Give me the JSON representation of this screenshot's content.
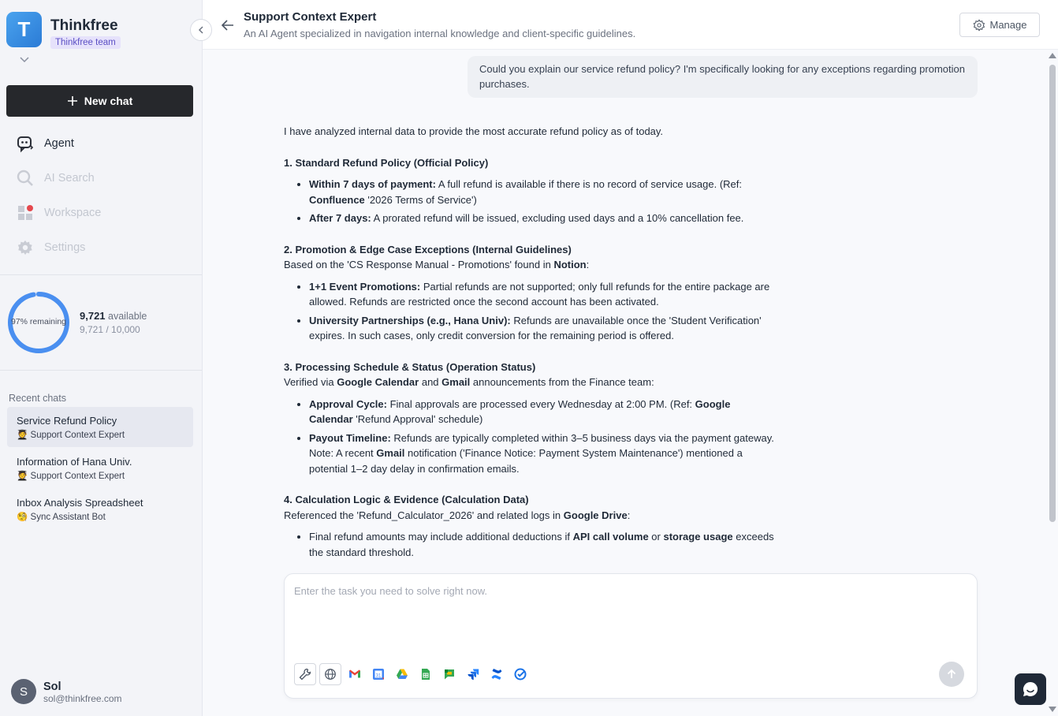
{
  "org": {
    "initial": "T",
    "name": "Thinkfree",
    "badge": "Thinkfree team"
  },
  "sidebar": {
    "new_chat": "New chat",
    "nav": [
      {
        "label": "Agent",
        "icon": "agent-icon",
        "enabled": true
      },
      {
        "label": "AI Search",
        "icon": "search-icon",
        "enabled": false
      },
      {
        "label": "Workspace",
        "icon": "workspace-grid-icon",
        "enabled": false
      },
      {
        "label": "Settings",
        "icon": "gear-icon",
        "enabled": false
      }
    ],
    "credits": {
      "remaining_label": "97% remaining",
      "remaining_fraction": 0.97,
      "available_value": "9,721",
      "available_suffix": "available",
      "total": "9,721 / 10,000"
    },
    "recent_title": "Recent chats",
    "recent": [
      {
        "title": "Service Refund Policy",
        "agent_emoji": "🧑‍🎓",
        "agent": "Support Context Expert",
        "active": true
      },
      {
        "title": "Information of Hana Univ.",
        "agent_emoji": "🧑‍🎓",
        "agent": "Support Context Expert",
        "active": false
      },
      {
        "title": "Inbox Analysis Spreadsheet",
        "agent_emoji": "🧐",
        "agent": "Sync Assistant Bot",
        "active": false
      }
    ],
    "user": {
      "initial": "S",
      "name": "Sol",
      "email": "sol@thinkfree.com"
    }
  },
  "header": {
    "title": "Support Context Expert",
    "description": "An AI Agent specialized in navigation internal knowledge and client-specific guidelines.",
    "manage": "Manage"
  },
  "chat": {
    "user_message": "Could you explain our service refund policy? I'm specifically looking for any exceptions regarding promotion purchases.",
    "intro": "I have analyzed internal data to provide the most accurate refund policy as of today.",
    "s1": {
      "title": "1. Standard Refund Policy (Official Policy)",
      "b1_bold": "Within 7 days of payment:",
      "b1_text": " A full refund is available if there is no record of service usage. (Ref: ",
      "b1_bold2": "Confluence",
      "b1_text2": " '2026 Terms of Service')",
      "b2_bold": "After 7 days:",
      "b2_text": " A prorated refund will be issued, excluding used days and a 10% cancellation fee."
    },
    "s2": {
      "title": "2. Promotion & Edge Case Exceptions (Internal Guidelines)",
      "lead": "Based on the 'CS Response Manual - Promotions' found in ",
      "lead_bold": "Notion",
      "lead_end": ":",
      "b1_bold": "1+1 Event Promotions:",
      "b1_text": " Partial refunds are not supported; only full refunds for the entire package are allowed. Refunds are restricted once the second account has been activated.",
      "b2_bold": "University Partnerships (e.g., Hana Univ):",
      "b2_text": " Refunds are unavailable once the 'Student Verification' expires. In such cases, only credit conversion for the remaining period is offered."
    },
    "s3": {
      "title": "3. Processing Schedule & Status (Operation Status)",
      "lead": "Verified via ",
      "lead_bold": "Google Calendar",
      "lead_mid": " and ",
      "lead_bold2": "Gmail",
      "lead_end": " announcements from the Finance team:",
      "b1_bold": "Approval Cycle:",
      "b1_text": " Final approvals are processed every Wednesday at 2:00 PM. (Ref: ",
      "b1_bold2": "Google Calendar",
      "b1_text2": " 'Refund Approval' schedule)",
      "b2_bold": "Payout Timeline:",
      "b2_text": " Refunds are typically completed within 3–5 business days via the payment gateway. Note: A recent ",
      "b2_bold2": "Gmail",
      "b2_text2": " notification ('Finance Notice: Payment System Maintenance') mentioned a potential 1–2 day delay in confirmation emails."
    },
    "s4": {
      "title": "4. Calculation Logic & Evidence (Calculation Data)",
      "lead": "Referenced the 'Refund_Calculator_2026' and related logs in ",
      "lead_bold": "Google Drive",
      "lead_end": ":",
      "b1_text": "Final refund amounts may include additional deductions if ",
      "b1_bold": "API call volume",
      "b1_mid": " or ",
      "b1_bold2": "storage usage",
      "b1_text2": " exceeds the standard threshold."
    }
  },
  "composer": {
    "placeholder": "Enter the task you need to solve right now.",
    "tools": [
      "wrench-icon",
      "globe-icon"
    ],
    "apps": [
      "gmail-icon",
      "google-calendar-icon",
      "google-drive-icon",
      "google-sheets-icon",
      "google-chat-icon",
      "jira-icon",
      "confluence-icon",
      "tasks-check-icon"
    ]
  },
  "colors": {
    "accent": "#4a8ff0",
    "ring_track": "#dfe6f5",
    "dark": "#26282c",
    "notification": "#e5484d"
  }
}
